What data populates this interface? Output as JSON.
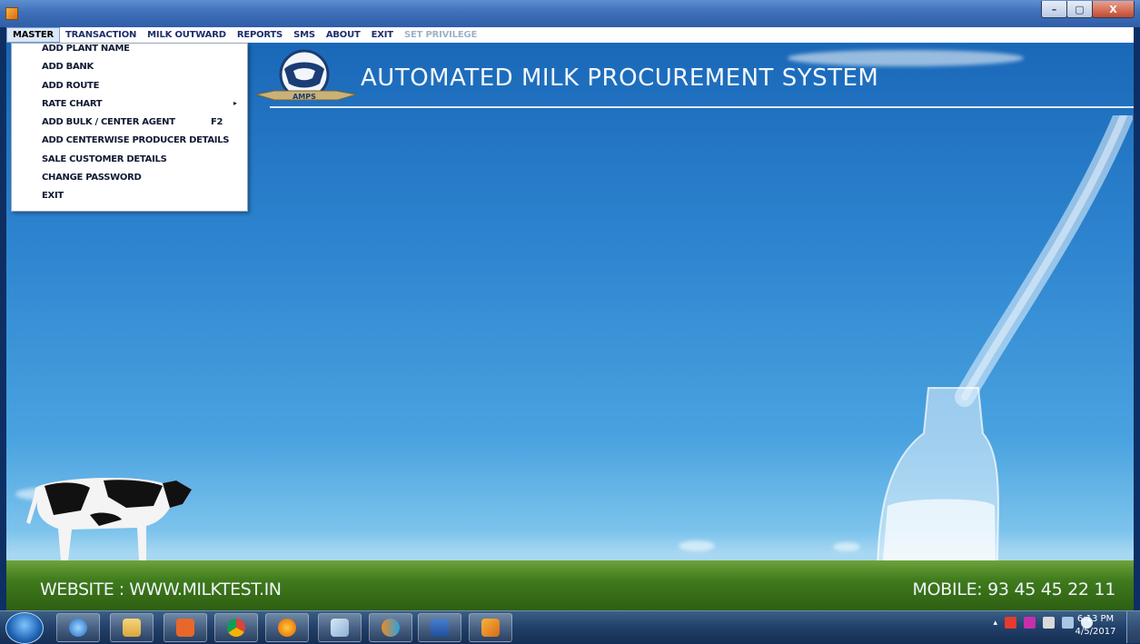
{
  "window": {
    "controls": {
      "minimize": "–",
      "maximize": "▢",
      "close": "X"
    }
  },
  "menubar": {
    "items": [
      {
        "label": "MASTER",
        "state": "active"
      },
      {
        "label": "TRANSACTION",
        "state": "normal"
      },
      {
        "label": "MILK OUTWARD",
        "state": "normal"
      },
      {
        "label": "REPORTS",
        "state": "normal"
      },
      {
        "label": "SMS",
        "state": "normal"
      },
      {
        "label": "ABOUT",
        "state": "normal"
      },
      {
        "label": "EXIT",
        "state": "normal"
      },
      {
        "label": "SET PRIVILEGE",
        "state": "disabled"
      }
    ]
  },
  "master_menu": {
    "items": [
      {
        "label": "ADD PLANT NAME"
      },
      {
        "label": "ADD BANK"
      },
      {
        "label": "ADD ROUTE"
      },
      {
        "label": "RATE CHART",
        "submenu_arrow": "▸"
      },
      {
        "label": "ADD BULK / CENTER AGENT",
        "shortcut": "F2"
      },
      {
        "label": "ADD CENTERWISE PRODUCER DETAILS"
      },
      {
        "label": "SALE CUSTOMER DETAILS"
      },
      {
        "label": "CHANGE PASSWORD"
      },
      {
        "label": "EXIT"
      }
    ]
  },
  "banner": {
    "title": "AUTOMATED MILK PROCUREMENT SYSTEM",
    "logo_text": "AMPS"
  },
  "footer": {
    "website": "WEBSITE : WWW.MILKTEST.IN",
    "mobile": "MOBILE: 93 45 45 22 11"
  },
  "taskbar": {
    "pinned": [
      "internet-explorer-icon",
      "file-explorer-icon",
      "media-player-icon",
      "chrome-icon",
      "firefox-icon",
      "snipping-tool-icon",
      "butterfly-app-icon",
      "word-icon",
      "amps-app-icon"
    ],
    "tray_expand": "▴",
    "clock": {
      "time": "6:13 PM",
      "date": "4/5/2017"
    }
  }
}
